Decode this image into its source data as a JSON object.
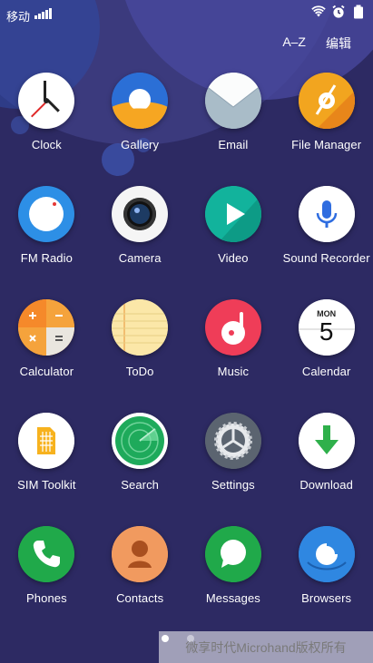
{
  "status_bar": {
    "carrier": "移动",
    "icons": [
      "signal-icon",
      "wifi-icon",
      "alarm-icon",
      "battery-icon"
    ]
  },
  "top_actions": {
    "sort": "A–Z",
    "edit": "编辑"
  },
  "apps": [
    {
      "label": "Clock",
      "icon": "clock-icon"
    },
    {
      "label": "Gallery",
      "icon": "gallery-icon"
    },
    {
      "label": "Email",
      "icon": "email-icon"
    },
    {
      "label": "File Manager",
      "icon": "file-manager-icon"
    },
    {
      "label": "FM Radio",
      "icon": "fm-radio-icon"
    },
    {
      "label": "Camera",
      "icon": "camera-icon"
    },
    {
      "label": "Video",
      "icon": "video-icon"
    },
    {
      "label": "Sound Recorder",
      "icon": "sound-recorder-icon"
    },
    {
      "label": "Calculator",
      "icon": "calculator-icon"
    },
    {
      "label": "ToDo",
      "icon": "todo-icon"
    },
    {
      "label": "Music",
      "icon": "music-icon"
    },
    {
      "label": "Calendar",
      "icon": "calendar-icon"
    },
    {
      "label": "SIM Toolkit",
      "icon": "sim-toolkit-icon"
    },
    {
      "label": "Search",
      "icon": "search-icon"
    },
    {
      "label": "Settings",
      "icon": "settings-icon"
    },
    {
      "label": "Download",
      "icon": "download-icon"
    },
    {
      "label": "Phones",
      "icon": "phone-icon"
    },
    {
      "label": "Contacts",
      "icon": "contacts-icon"
    },
    {
      "label": "Messages",
      "icon": "messages-icon"
    },
    {
      "label": "Browsers",
      "icon": "browser-icon"
    }
  ],
  "calendar": {
    "day": "MON",
    "date": "5"
  },
  "watermark": "微享时代Microhand版权所有"
}
